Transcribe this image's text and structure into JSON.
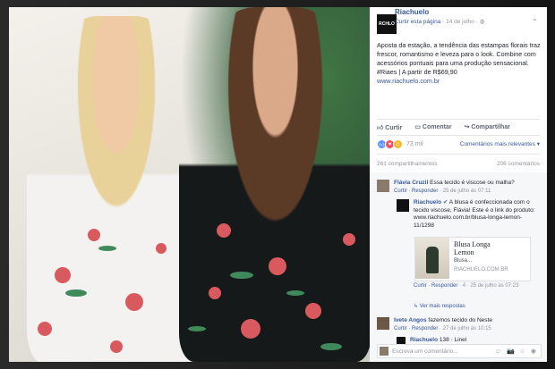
{
  "post": {
    "page_name": "Riachuelo",
    "logo_text": "RCHLO",
    "follow_label": "Curtir esta página",
    "date": "14 de julho",
    "caption": "Aposta da estação, a tendência das estampas florais traz frescor, romantismo e leveza para o look. Combine com acessórios pontuais para uma produção sensacional. #Riaes | A partir de R$69,90",
    "link": "www.riachuelo.com.br"
  },
  "actions": {
    "like": "Curtir",
    "comment": "Comentar",
    "share": "Compartilhar"
  },
  "reactions": {
    "count": "73 mil",
    "relevance": "Comentários mais relevantes ▾"
  },
  "stats": {
    "shares": "261 compartilhamentos",
    "comments": "206 comentários"
  },
  "comments": [
    {
      "name": "Flávia Cruzil",
      "text": "Essa tecido é viscose ou malha?",
      "meta_action": "Curtir · Responder",
      "meta_time": "25 de julho às 07:11"
    },
    {
      "name": "Riachuelo",
      "text": "A blusa é confeccionada com o tecido viscose, Flávia! Este é o link do produto: www.riachuelo.com.br/blusa-longa-lemon-11/1298",
      "meta_action": "Curtir · Responder",
      "meta_time": "4 · 25 de julho às 07:23"
    },
    {
      "name": "Ivete Angos",
      "text": "fazemos tecido do Neste",
      "meta_action": "Curtir · Responder",
      "meta_time": "27 de julho às 10:15"
    },
    {
      "name": "Riachuelo",
      "text": "138 · Linel",
      "meta_action": "",
      "meta_time": ""
    }
  ],
  "replies_link": "↳ Ver mais respostas",
  "card": {
    "title1": "Blusa Longa",
    "title2": "Lemon",
    "desc": "Blusa...",
    "domain": "RIACHUELO.COM.BR"
  },
  "write_placeholder": "Escreva um comentário...",
  "write_icons": "☺ 📷 ☆ ◉"
}
